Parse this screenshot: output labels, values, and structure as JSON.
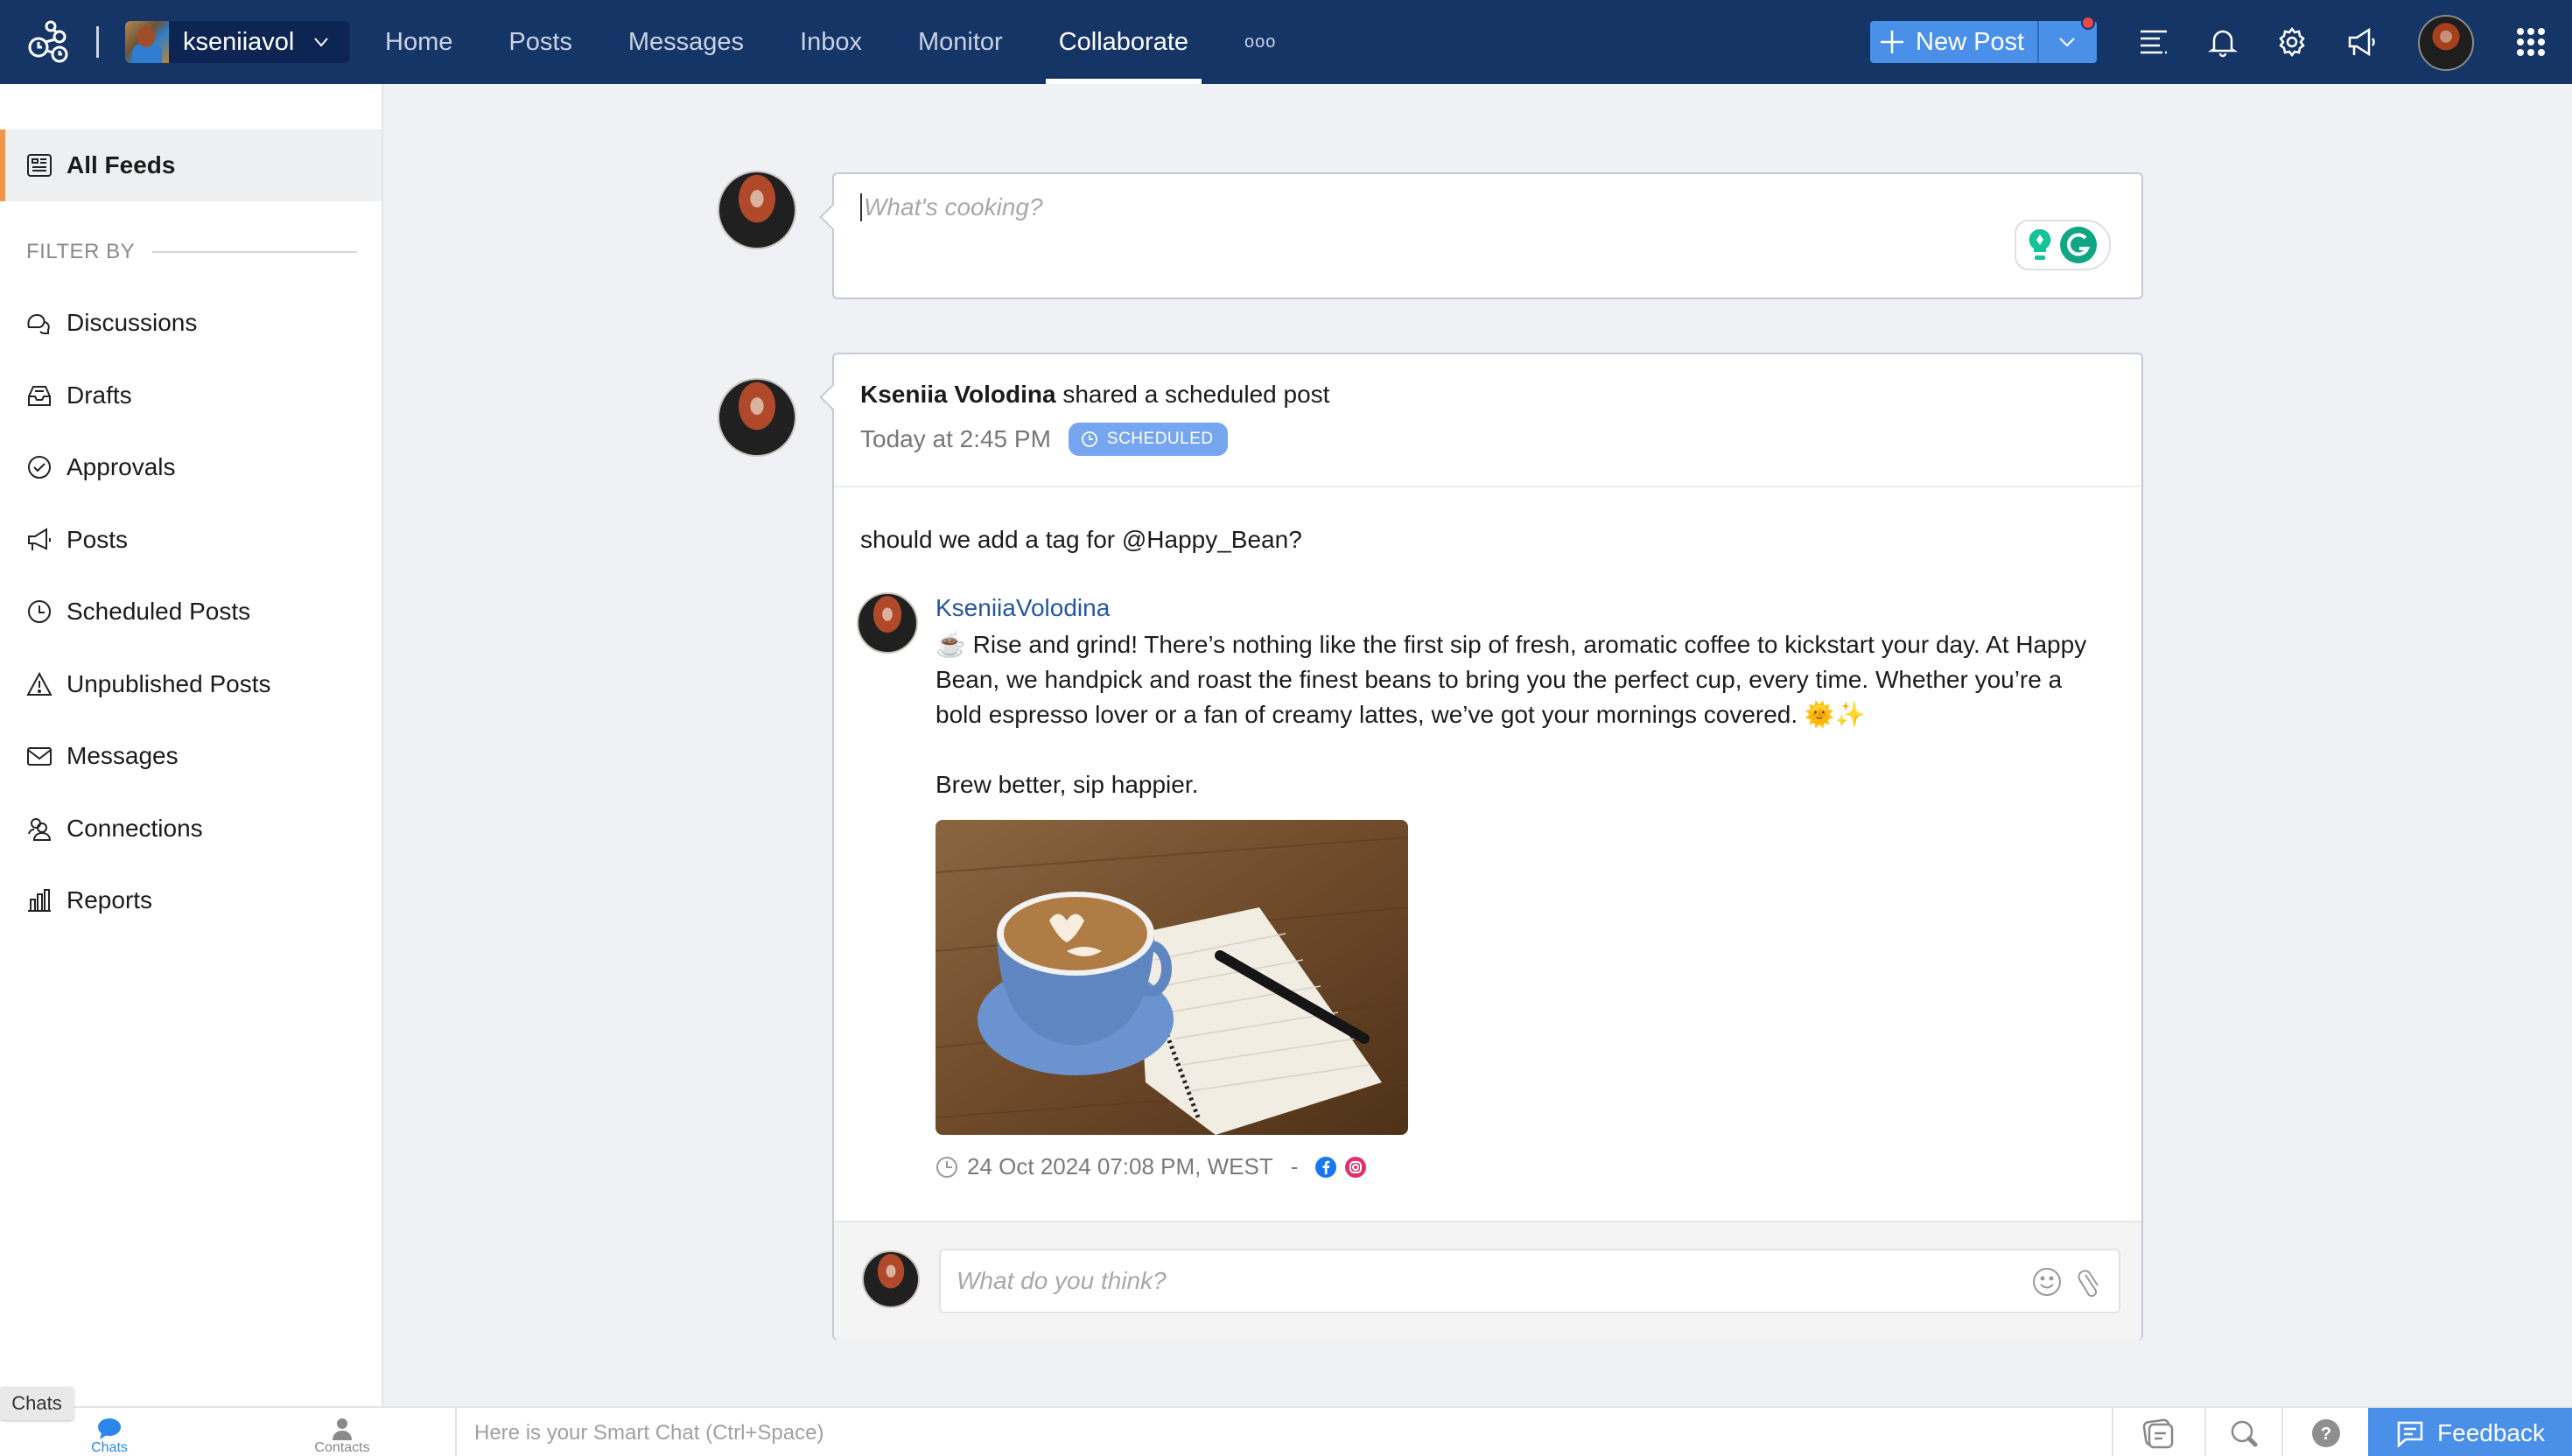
{
  "header": {
    "account_name": "kseniiavol",
    "nav": [
      {
        "label": "Home",
        "active": false
      },
      {
        "label": "Posts",
        "active": false
      },
      {
        "label": "Messages",
        "active": false
      },
      {
        "label": "Inbox",
        "active": false
      },
      {
        "label": "Monitor",
        "active": false
      },
      {
        "label": "Collaborate",
        "active": true
      }
    ],
    "more_label": "ooo",
    "new_post_label": "New Post",
    "icons": [
      "list-icon",
      "bell-icon",
      "gear-icon",
      "megaphone-icon",
      "user-avatar",
      "apps-grid-icon"
    ],
    "notification_dot_color": "#e84a4a"
  },
  "sidebar": {
    "active_item": {
      "label": "All Feeds",
      "icon": "feed-icon"
    },
    "filter_label": "FILTER BY",
    "items": [
      {
        "label": "Discussions",
        "icon": "chat-bubbles-icon"
      },
      {
        "label": "Drafts",
        "icon": "inbox-tray-icon"
      },
      {
        "label": "Approvals",
        "icon": "badge-check-icon"
      },
      {
        "label": "Posts",
        "icon": "megaphone-icon"
      },
      {
        "label": "Scheduled Posts",
        "icon": "clock-icon"
      },
      {
        "label": "Unpublished Posts",
        "icon": "warning-icon"
      },
      {
        "label": "Messages",
        "icon": "envelope-icon"
      },
      {
        "label": "Connections",
        "icon": "users-icon"
      },
      {
        "label": "Reports",
        "icon": "bar-chart-icon"
      }
    ]
  },
  "composer": {
    "placeholder": "What's cooking?"
  },
  "post": {
    "author": "Kseniia Volodina",
    "action": "shared a scheduled post",
    "time": "Today at 2:45 PM",
    "badge": "SCHEDULED",
    "comment": "should we add a tag for @Happy_Bean?",
    "shared": {
      "author": "KseniiaVolodina",
      "body": "☕ Rise and grind! There’s nothing like the first sip of fresh, aromatic coffee to kickstart your day. At Happy Bean, we handpick and roast the finest beans to bring you the perfect cup, every time. Whether you’re a bold espresso lover or a fan of creamy lattes, we’ve got your mornings covered. 🌞✨\n\nBrew better, sip happier.",
      "image_alt": "Latte in blue cup with notebook and pen on wooden table",
      "schedule": "24 Oct 2024 07:08 PM, WEST",
      "separator": "-",
      "networks": [
        "facebook",
        "instagram"
      ]
    },
    "reply_placeholder": "What do you think?"
  },
  "bottombar": {
    "tooltip": "Chats",
    "chats_label": "Chats",
    "contacts_label": "Contacts",
    "smart_chat": "Here is your Smart Chat (Ctrl+Space)",
    "feedback_label": "Feedback"
  },
  "colors": {
    "header_bg": "#163567",
    "accent": "#4a90e8",
    "sidebar_active_marker": "#f0954a",
    "badge_bg": "#75a6ef",
    "link": "#2456a4"
  }
}
